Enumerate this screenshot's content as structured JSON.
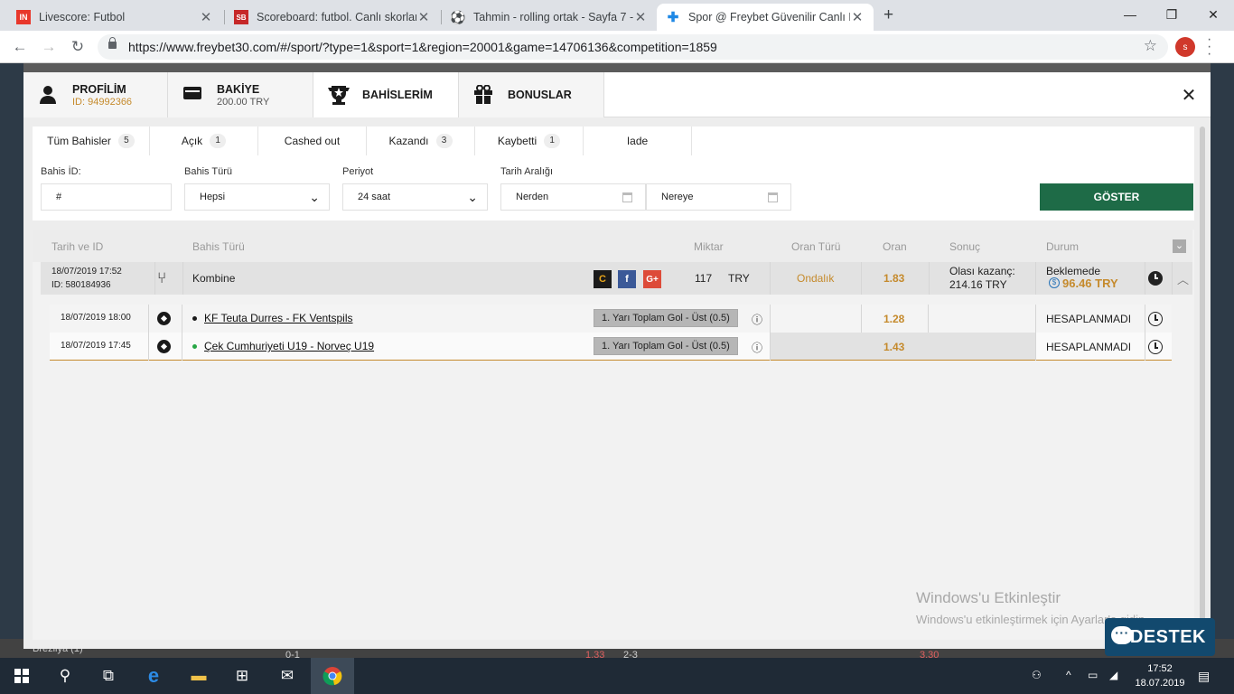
{
  "browser": {
    "tabs": [
      {
        "favicon": "IN",
        "title": "Livescore: Futbol"
      },
      {
        "favicon": "SB",
        "title": "Scoreboard: futbol. Canlı skorlar,"
      },
      {
        "favicon": "⚽",
        "title": "Tahmin - rolling ortak - Sayfa 7 -"
      },
      {
        "favicon": "✚",
        "title": "Spor @ Freybet Güvenilir Canlı B"
      }
    ],
    "url": "https://www.freybet30.com/#/sport/?type=1&sport=1&region=20001&game=14706136&competition=1859",
    "profile_initial": "s"
  },
  "modal": {
    "tabs": {
      "profile": {
        "label": "PROFİLİM",
        "sub": "ID: 94992366"
      },
      "balance": {
        "label": "BAKİYE",
        "sub": "200.00 TRY"
      },
      "bets": {
        "label": "BAHİSLERİM"
      },
      "bonuses": {
        "label": "BONUSLAR"
      }
    },
    "subtabs": [
      {
        "label": "Tüm Bahisler",
        "count": "5"
      },
      {
        "label": "Açık",
        "count": "1"
      },
      {
        "label": "Cashed out",
        "count": ""
      },
      {
        "label": "Kazandı",
        "count": "3"
      },
      {
        "label": "Kaybetti",
        "count": "1"
      },
      {
        "label": "Iade",
        "count": ""
      }
    ],
    "filters": {
      "bet_id_label": "Bahis İD:",
      "bet_id_value": "#",
      "bet_type_label": "Bahis Türü",
      "bet_type_value": "Hepsi",
      "period_label": "Periyot",
      "period_value": "24 saat",
      "date_range_label": "Tarih Aralığı",
      "from": "Nerden",
      "to": "Nereye",
      "show_button": "GÖSTER"
    },
    "table": {
      "headers": {
        "date_id": "Tarih ve ID",
        "bet_type": "Bahis Türü",
        "amount": "Miktar",
        "odds_type": "Oran Türü",
        "odds": "Oran",
        "result": "Sonuç",
        "status": "Durum"
      },
      "bet": {
        "date": "18/07/2019 17:52",
        "id": "ID: 580184936",
        "type": "Kombine",
        "amount": "117",
        "currency": "TRY",
        "odds_type": "Ondalık",
        "odds": "1.83",
        "possible_win_label": "Olası kazanç:",
        "possible_win": "214.16 TRY",
        "status": "Beklemede",
        "cashout": "96.46 TRY",
        "social": [
          "C",
          "f",
          "G+"
        ]
      },
      "selections": [
        {
          "date": "18/07/2019 18:00",
          "match": "KF Teuta Durres - FK Ventspils",
          "market": "1. Yarı Toplam Gol - Üst (0.5)",
          "odds": "1.28",
          "status": "HESAPLANMADI",
          "dot": "#1a1a1a"
        },
        {
          "date": "18/07/2019 17:45",
          "match": "Çek Cumhuriyeti U19 - Norveç U19",
          "market": "1. Yarı Toplam Gol - Üst (0.5)",
          "odds": "1.43",
          "status": "HESAPLANMADI",
          "dot": "#27a745"
        }
      ]
    }
  },
  "overlay": {
    "watermark_title": "Windows'u Etkinleştir",
    "watermark_sub": "Windows'u etkinleştirmek için Ayarlar'a gidin.",
    "support": "DESTEK"
  },
  "background": {
    "bottom_left": "Brezilya (1)",
    "score1": "0-1",
    "score2": "1.33",
    "score3": "2-3",
    "score4": "3.30"
  },
  "taskbar": {
    "time": "17:52",
    "date": "18.07.2019"
  },
  "colors": {
    "accent_green": "#1e6b47",
    "odds_orange": "#c58a2c",
    "support_blue": "#12496e"
  }
}
